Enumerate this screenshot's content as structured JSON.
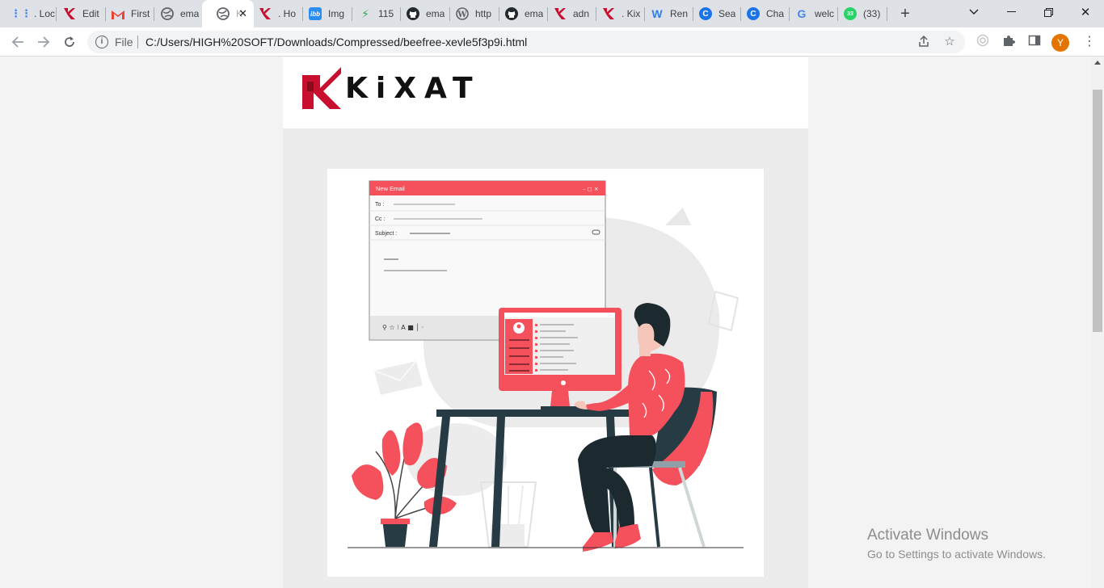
{
  "browser": {
    "tabs": [
      {
        "title": ". Loc",
        "icon": "grid-dots-icon",
        "color": "#4285f4"
      },
      {
        "title": "Edit",
        "icon": "kixat-logo-icon",
        "color": "#c8102e"
      },
      {
        "title": "First",
        "icon": "gmail-icon",
        "color": "#ea4335"
      },
      {
        "title": "ema",
        "icon": "globe-icon",
        "color": "#5f6368"
      },
      {
        "title": "K",
        "icon": "globe-icon",
        "color": "#5f6368",
        "active": true
      },
      {
        "title": ". Ho",
        "icon": "kixat-logo-icon",
        "color": "#c8102e"
      },
      {
        "title": "Img",
        "icon": "ibb-icon",
        "color": "#2d8cf0"
      },
      {
        "title": "115",
        "icon": "bolt-icon",
        "color": "#34a853"
      },
      {
        "title": "ema",
        "icon": "github-icon",
        "color": "#24292e"
      },
      {
        "title": "http",
        "icon": "wordpress-icon",
        "color": "#5f6368"
      },
      {
        "title": "ema",
        "icon": "github-icon",
        "color": "#24292e"
      },
      {
        "title": "adn",
        "icon": "kixat-logo-icon",
        "color": "#c8102e"
      },
      {
        "title": ". Kix",
        "icon": "kixat-logo-icon",
        "color": "#c8102e"
      },
      {
        "title": "Ren",
        "icon": "w-logo-icon",
        "color": "#2f80ed"
      },
      {
        "title": "Sea",
        "icon": "c-logo-icon",
        "color": "#1a73e8"
      },
      {
        "title": "Cha",
        "icon": "c-logo-icon",
        "color": "#1a73e8"
      },
      {
        "title": "welc",
        "icon": "google-icon",
        "color": "#4285f4"
      },
      {
        "title": "(33)",
        "icon": "whatsapp-icon",
        "color": "#25d366",
        "badge": "33"
      }
    ],
    "address": {
      "scheme_label": "File",
      "url": "C:/Users/HIGH%20SOFT/Downloads/Compressed/beefree-xevle5f3p9i.html"
    },
    "profile_initial": "Y"
  },
  "email": {
    "logo_text": "KiXAT",
    "illustration": {
      "window_title": "New Email",
      "to_label": "To :",
      "cc_label": "Cc :",
      "subject_label": "Subject :"
    }
  },
  "watermark": {
    "line1": "Activate Windows",
    "line2": "Go to Settings to activate Windows."
  },
  "colors": {
    "brand_red": "#c8102e",
    "accent_coral": "#f4515c",
    "dark_teal": "#263b44"
  }
}
